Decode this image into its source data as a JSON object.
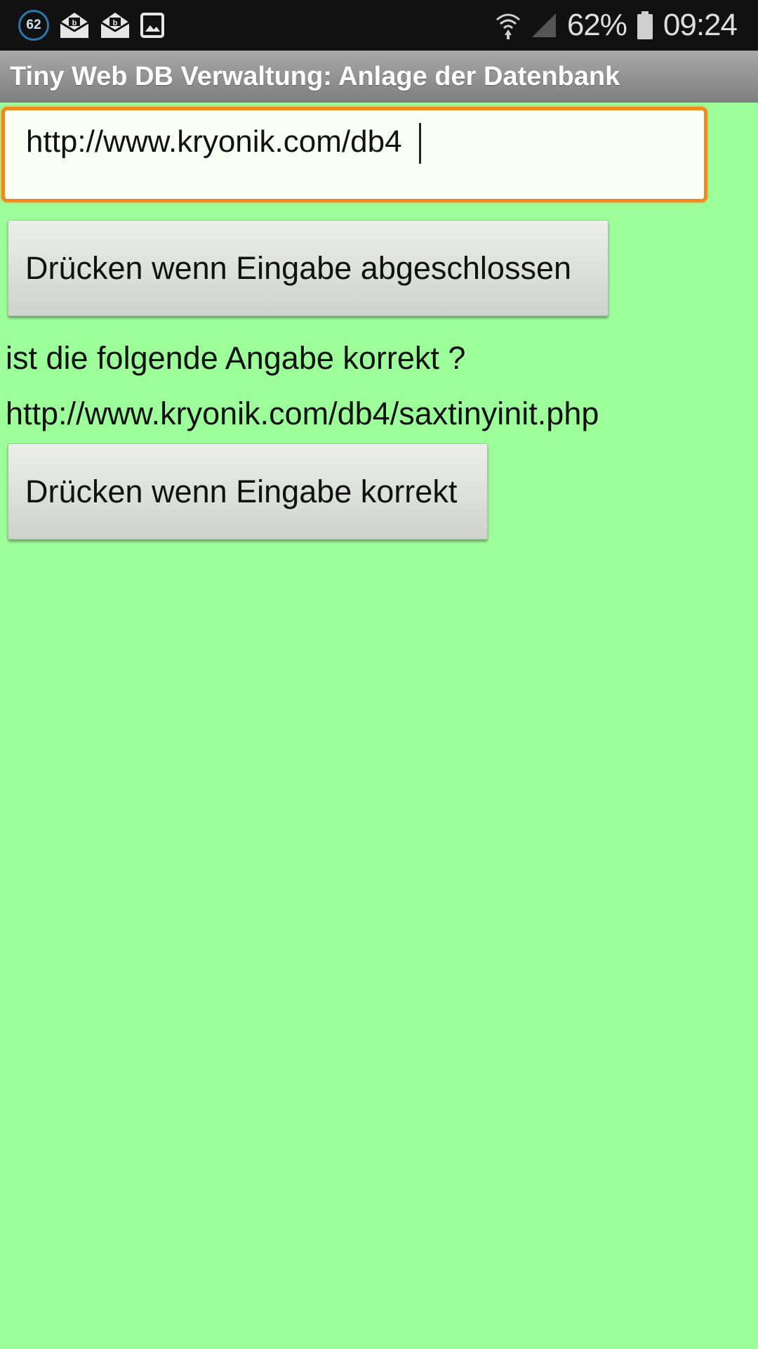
{
  "status_bar": {
    "notification_badge": "62",
    "battery_percent": "62%",
    "time": "09:24",
    "icons": [
      "notification-counter-icon",
      "mail-icon",
      "mail-icon",
      "image-icon",
      "wifi-icon",
      "signal-icon",
      "battery-icon"
    ]
  },
  "app": {
    "title": "Tiny Web DB Verwaltung: Anlage der Datenbank"
  },
  "form": {
    "url_input_value": "http://www.kryonik.com/db4",
    "submit_button_label": "Drücken wenn Eingabe abgeschlossen",
    "question_label": "ist die folgende Angabe korrekt ?",
    "resolved_url": "http://www.kryonik.com/db4/saxtinyinit.php",
    "confirm_button_label": "Drücken wenn Eingabe korrekt"
  },
  "colors": {
    "background": "#9cff9a",
    "input_border": "#f28a1b",
    "title_bar": "#8c8c8c"
  }
}
